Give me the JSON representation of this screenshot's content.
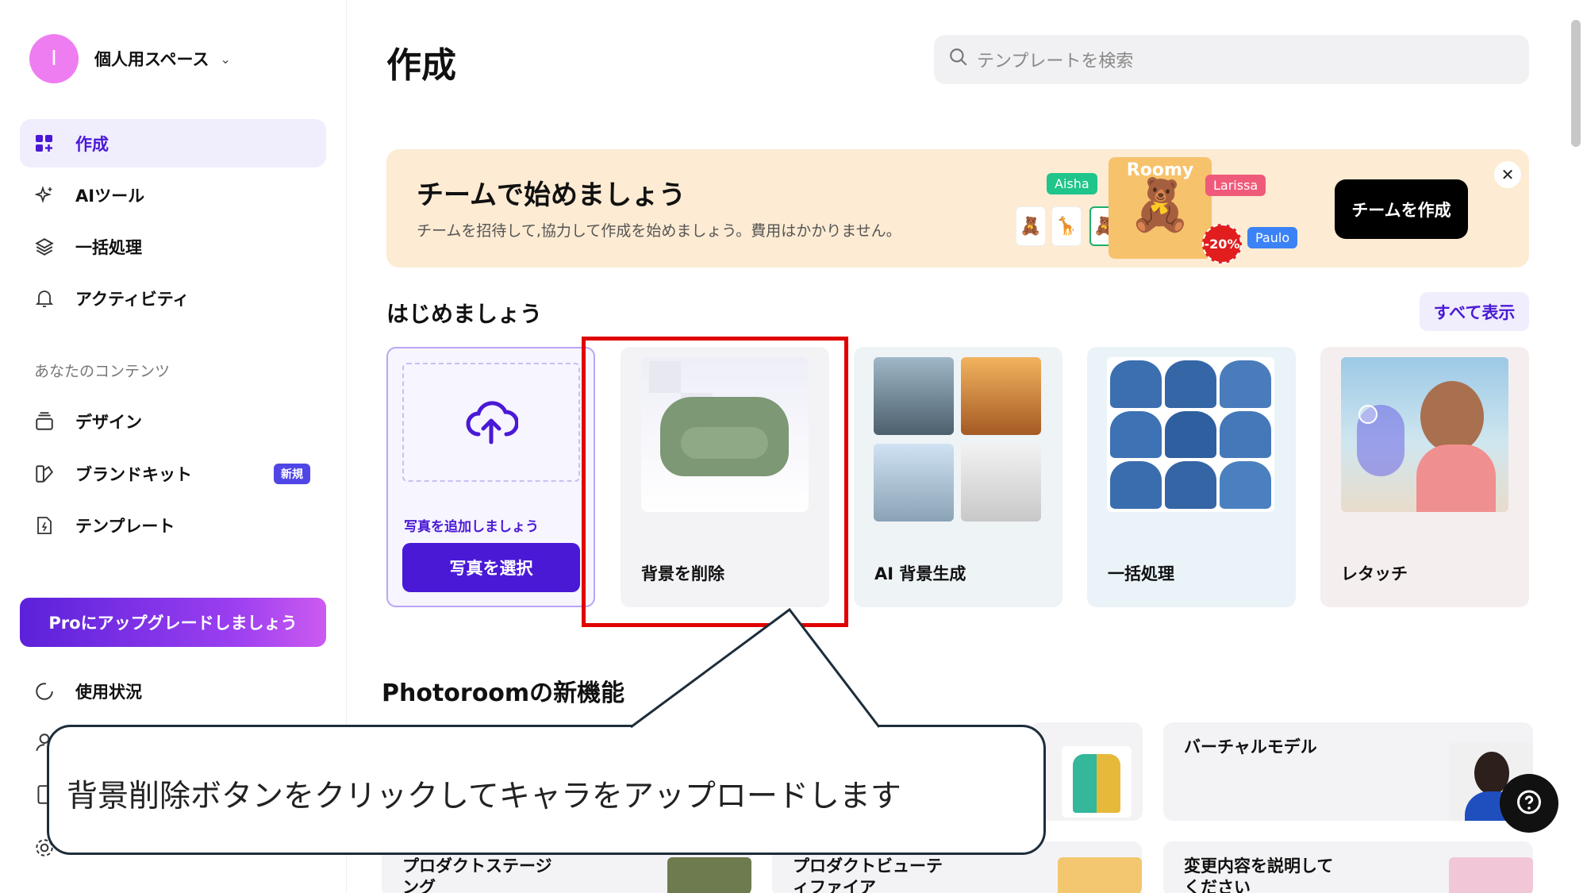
{
  "sidebar": {
    "workspace_initial": "I",
    "workspace_name": "個人用スペース",
    "items": [
      {
        "label": "作成"
      },
      {
        "label": "AIツール"
      },
      {
        "label": "一括処理"
      },
      {
        "label": "アクティビティ"
      }
    ],
    "content_section": "あなたのコンテンツ",
    "content_items": [
      {
        "label": "デザイン"
      },
      {
        "label": "ブランドキット",
        "badge": "新規"
      },
      {
        "label": "テンプレート"
      }
    ],
    "upgrade_label": "Proにアップグレードしましょう",
    "usage_label": "使用状況"
  },
  "header": {
    "title": "作成",
    "search_placeholder": "テンプレートを検索"
  },
  "banner": {
    "title": "チームで始めましょう",
    "subtitle": "チームを招待して,協力して作成を始めましょう。費用はかかりません。",
    "button": "チームを作成",
    "tags": [
      "Aisha",
      "Larissa",
      "Paulo"
    ],
    "product_name": "Roomy",
    "discount": "-20%"
  },
  "start": {
    "title": "はじめましょう",
    "see_all": "すべて表示",
    "upload_hint": "写真を追加しましょう",
    "upload_button": "写真を選択",
    "cards": [
      {
        "label": "背景を削除"
      },
      {
        "label": "AI 背景生成"
      },
      {
        "label": "一括処理"
      },
      {
        "label": "レタッチ"
      }
    ]
  },
  "new_features": {
    "title": "Photoroomの新機能",
    "cards": [
      {
        "label": "バーチャルモデル"
      },
      {
        "label": "プロダクトステージング"
      },
      {
        "label": "プロダクトビューティファイア"
      },
      {
        "label": "変更内容を説明してください"
      }
    ]
  },
  "callout": {
    "text": "背景削除ボタンをクリックしてキャラをアップロードします"
  },
  "colors": {
    "accent": "#4a19d6",
    "highlight": "#e00000",
    "banner_bg": "#fdebd3"
  }
}
